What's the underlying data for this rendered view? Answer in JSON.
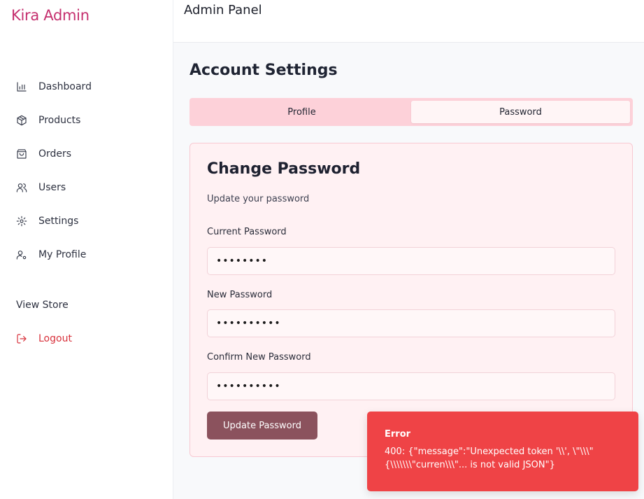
{
  "brand": {
    "name": "Kira Admin",
    "color": "#c5306f"
  },
  "sidebar": {
    "items": [
      {
        "label": "Dashboard",
        "icon": "bar-chart-icon"
      },
      {
        "label": "Products",
        "icon": "package-icon"
      },
      {
        "label": "Orders",
        "icon": "shopping-bag-icon"
      },
      {
        "label": "Users",
        "icon": "users-icon"
      },
      {
        "label": "Settings",
        "icon": "gear-icon"
      },
      {
        "label": "My Profile",
        "icon": "user-cog-icon"
      }
    ],
    "view_store": "View Store",
    "logout": {
      "label": "Logout",
      "icon": "logout-icon",
      "color": "#d8323c"
    }
  },
  "header": {
    "title": "Admin Panel"
  },
  "main": {
    "title": "Account Settings",
    "tabs": [
      {
        "label": "Profile",
        "active": false
      },
      {
        "label": "Password",
        "active": true
      }
    ],
    "card": {
      "title": "Change Password",
      "subtitle": "Update your password",
      "fields": [
        {
          "label": "Current Password",
          "value": "••••••••"
        },
        {
          "label": "New Password",
          "value": "••••••••••"
        },
        {
          "label": "Confirm New Password",
          "value": "••••••••••"
        }
      ],
      "submit_label": "Update Password"
    }
  },
  "toast": {
    "title": "Error",
    "message": "400: {\"message\":\"Unexpected token '\\\\', \\\"\\\\\\\"{\\\\\\\\\\\\\\\"curren\\\\\\\"... is not valid JSON\"}",
    "color": "#ef4346"
  }
}
